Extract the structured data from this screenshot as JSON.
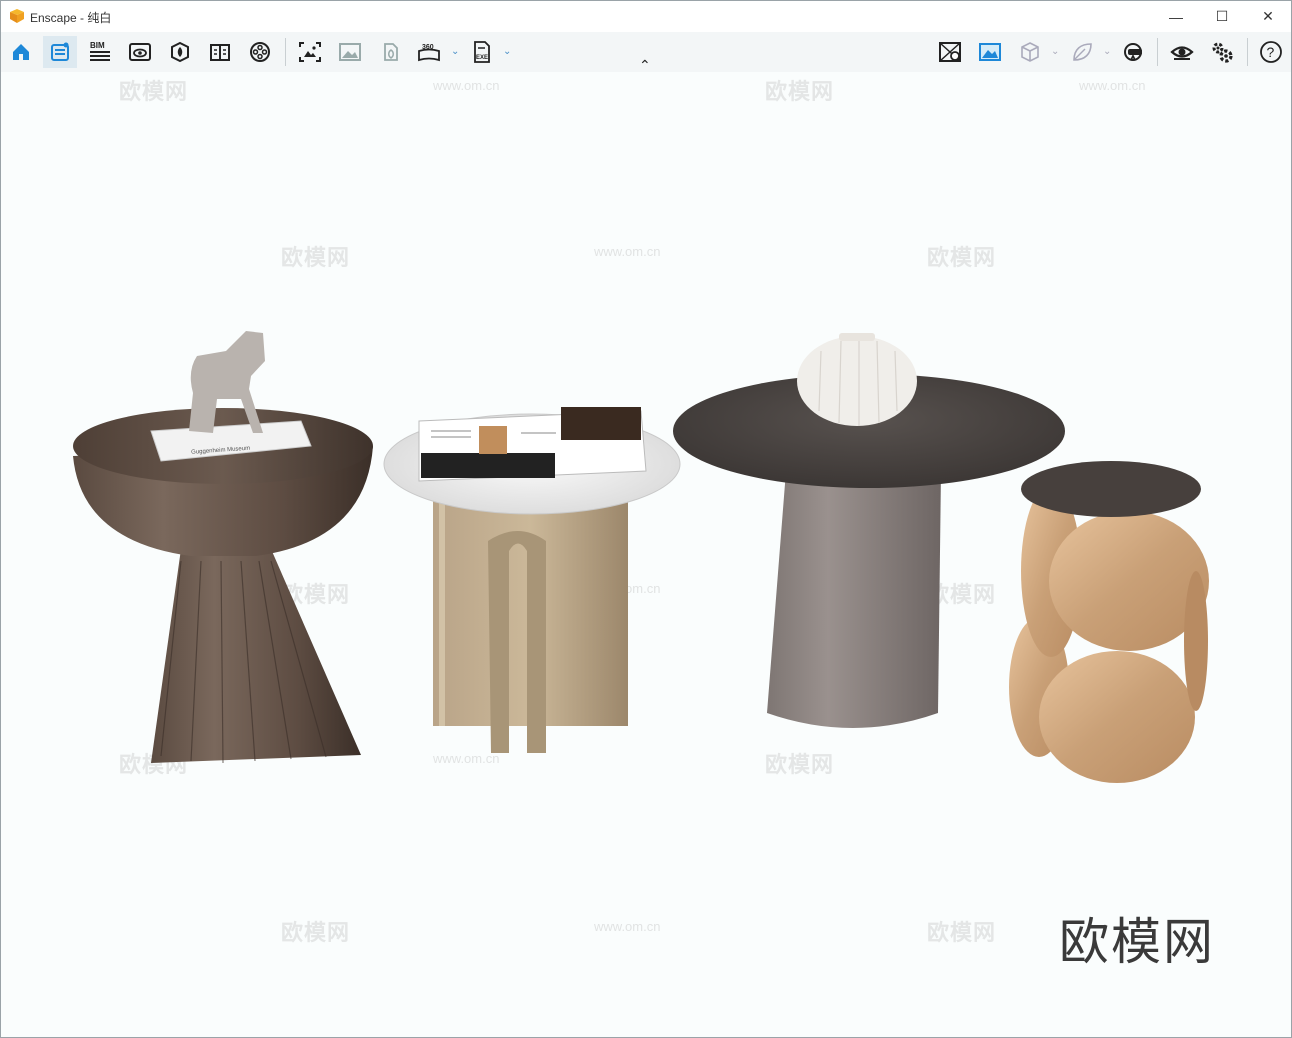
{
  "window": {
    "title": "Enscape - 纯白",
    "controls": {
      "minimize": "—",
      "maximize": "☐",
      "close": "✕"
    }
  },
  "toolbar": {
    "left_icons": [
      "home-icon",
      "notes-icon",
      "bim-icon",
      "view-icon",
      "asset-library-icon",
      "book-icon",
      "video-icon",
      "screenshot-icon",
      "image-icon",
      "panorama-icon",
      "360-icon",
      "exe-export-icon"
    ],
    "bim_label": "BIM",
    "pano_label": "360",
    "exe_label": "EXE",
    "right_icons": [
      "material-editor-icon",
      "visual-settings-icon",
      "cube-icon",
      "leaf-icon",
      "vr-headset-icon",
      "eye-icon",
      "settings-icon",
      "help-icon"
    ],
    "collapse_glyph": "⌃"
  },
  "viewport": {
    "watermark_text": "欧模网",
    "watermark_url": "www.om.cn",
    "brand_text": "欧模网",
    "book_title": "Guggenheim Museum"
  },
  "colors": {
    "accent": "#1e88d8",
    "logo_orange": "#f0a020",
    "toolbar_bg": "#f3f6f7",
    "viewport_bg": "#fafdfd"
  }
}
